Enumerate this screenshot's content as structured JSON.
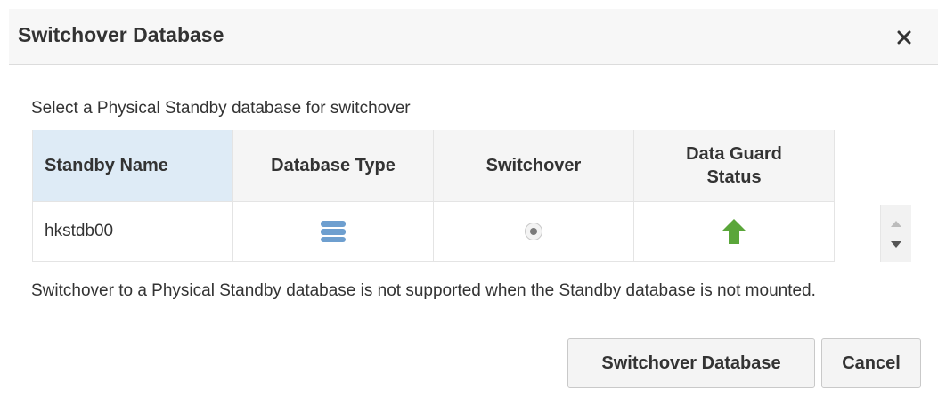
{
  "dialog": {
    "title": "Switchover Database",
    "instruction": "Select a Physical Standby database for switchover",
    "warning": "Switchover to a Physical Standby database is not supported when the Standby database is not mounted."
  },
  "table": {
    "columns": [
      "Standby Name",
      "Database Type",
      "Switchover",
      "Data Guard Status"
    ],
    "rows": [
      {
        "standby_name": "hkstdb00",
        "database_type_icon": "database-icon",
        "switchover_selected": true,
        "status_icon": "up-arrow-icon"
      }
    ]
  },
  "buttons": {
    "switchover": "Switchover Database",
    "cancel": "Cancel"
  },
  "colors": {
    "header_selected": "#deebf6",
    "status_up": "#5aa63a",
    "db_icon": "#6e9fcf"
  }
}
